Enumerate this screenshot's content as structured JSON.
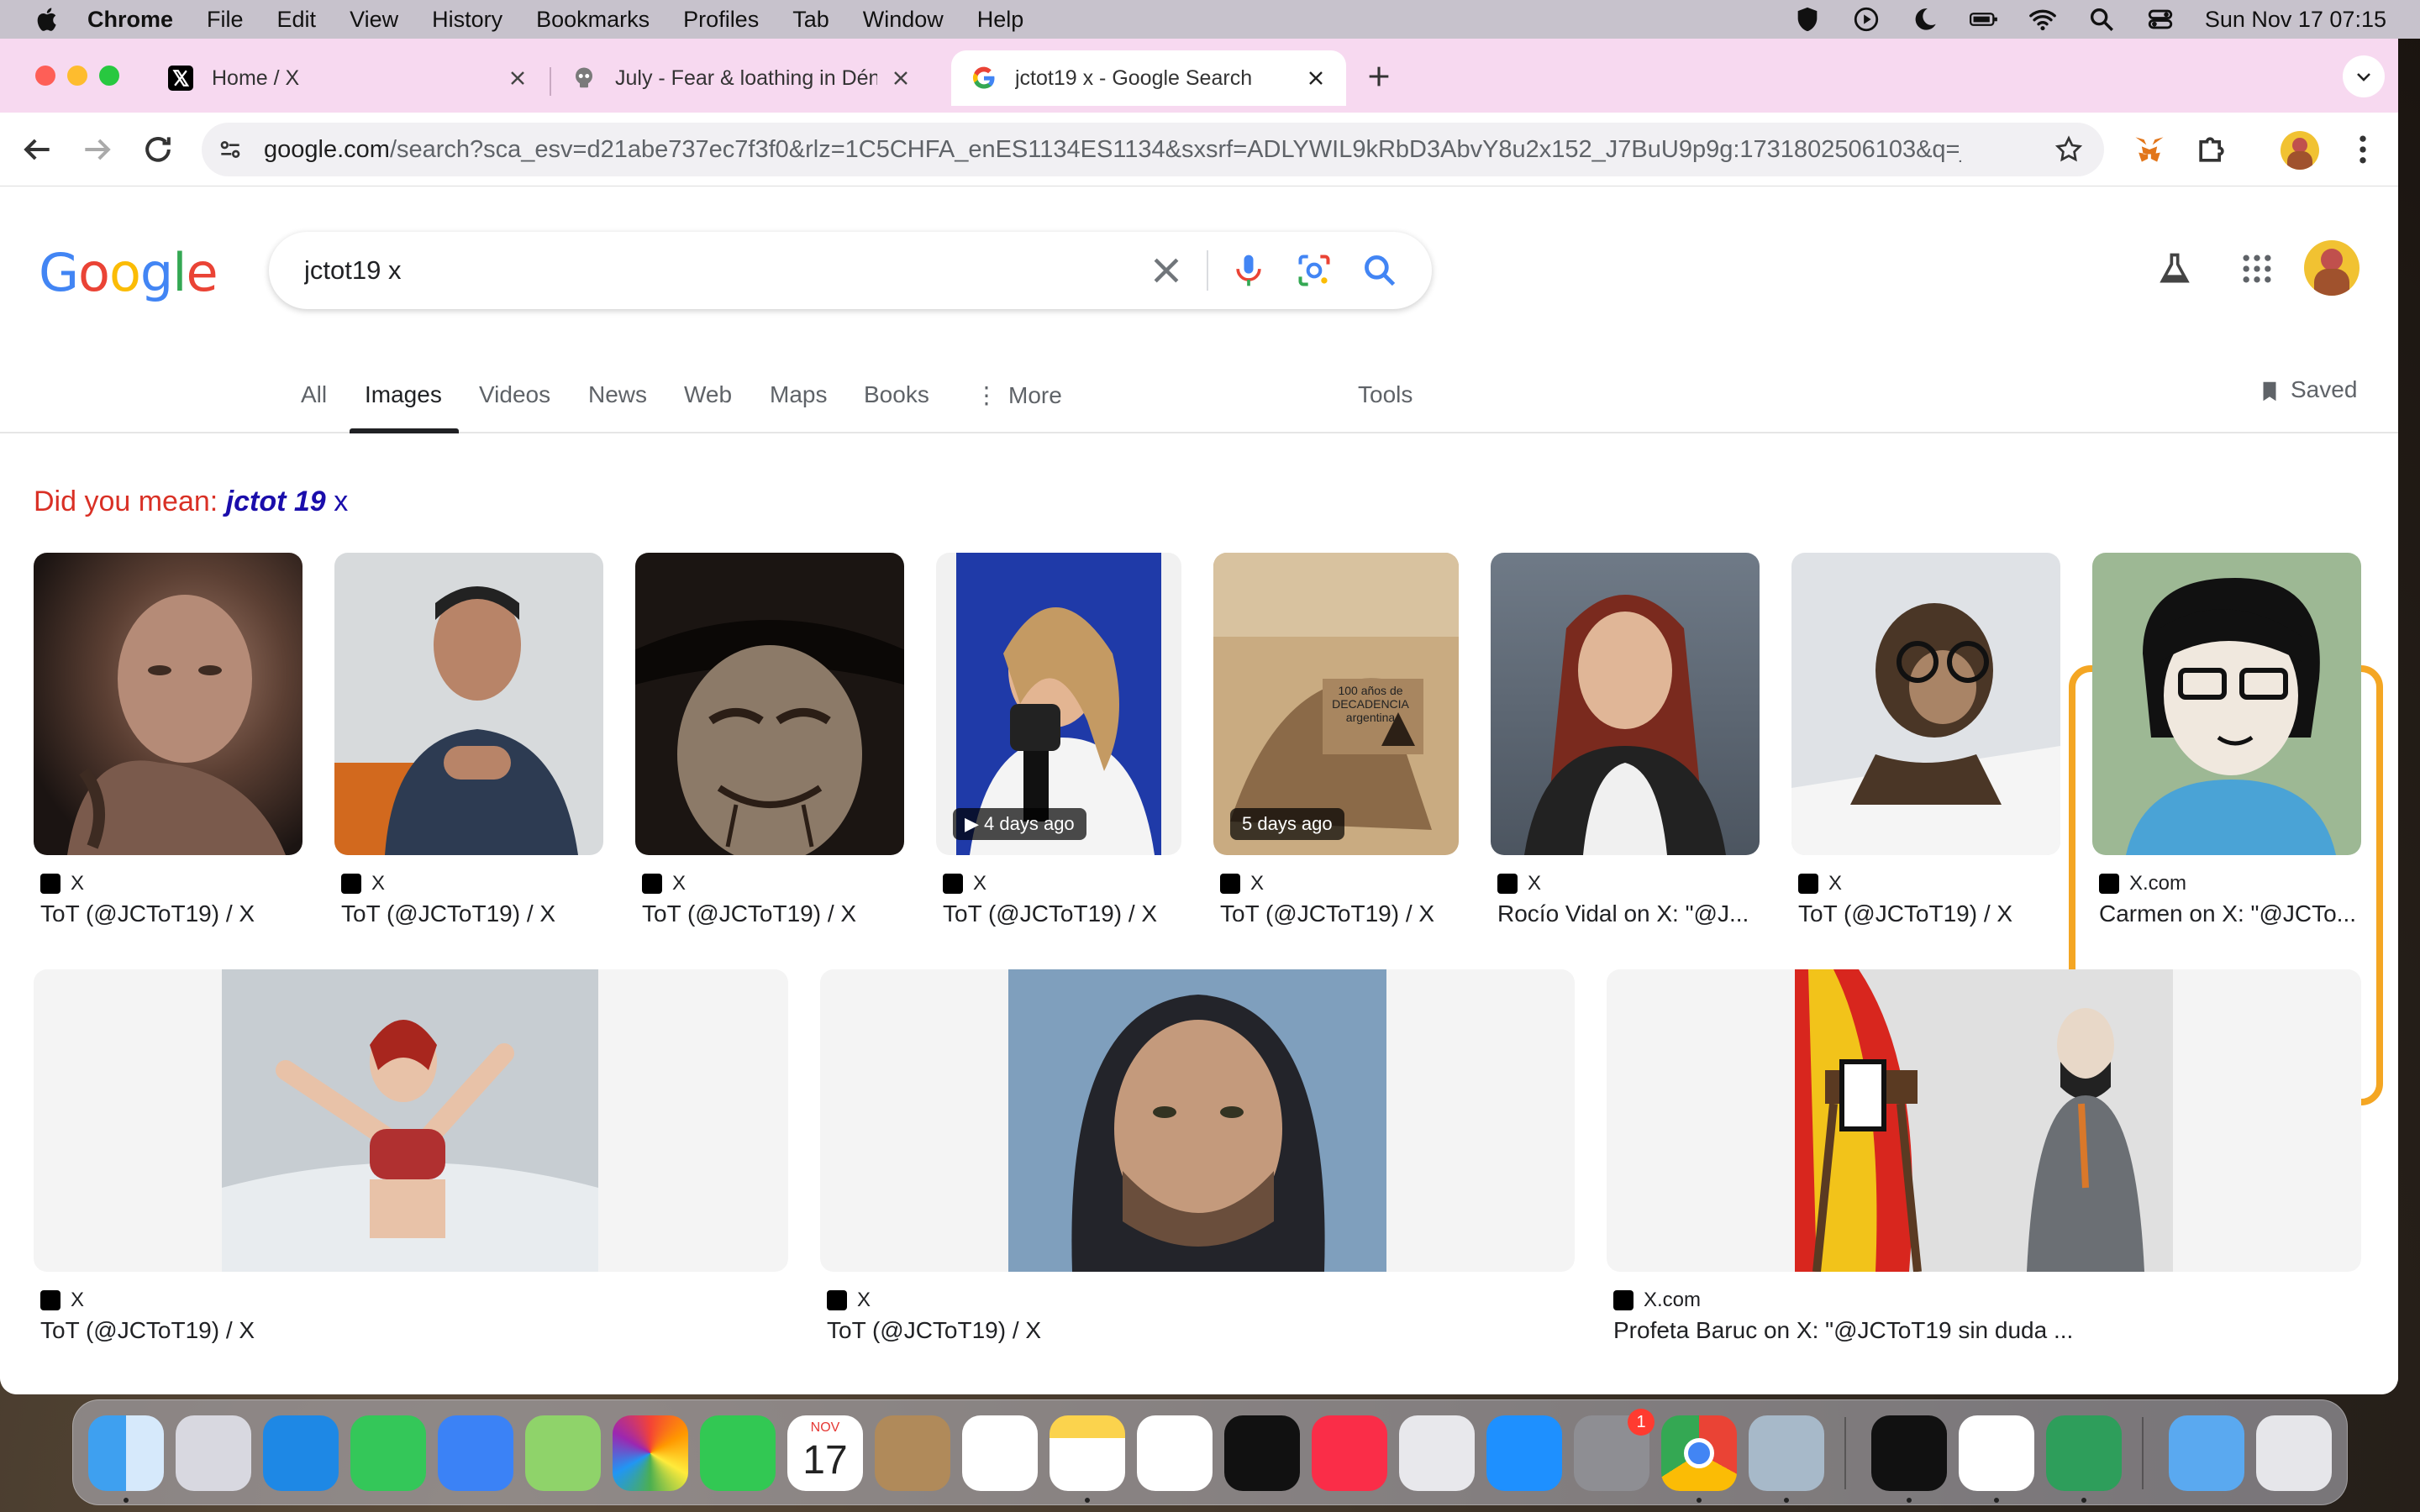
{
  "menubar": {
    "items": [
      "Chrome",
      "File",
      "Edit",
      "View",
      "History",
      "Bookmarks",
      "Profiles",
      "Tab",
      "Window",
      "Help"
    ],
    "clock": "Sun Nov 17  07:15"
  },
  "tabs": [
    {
      "title": "Home / X"
    },
    {
      "title": "July - Fear & loathing in Dénia"
    },
    {
      "title": "jctot19 x - Google Search"
    }
  ],
  "address_bar": {
    "domain": "google.com",
    "path": "/search?sca_esv=d21abe737ec7f3f0&rlz=1C5CHFA_enES1134ES1134&sxsrf=ADLYWIL9kRbD3AbvY8u2x152_J7BuU9p9g:1731802506103&q=jct..."
  },
  "search": {
    "query": "jctot19 x"
  },
  "logo": {
    "letters": [
      "G",
      "o",
      "o",
      "g",
      "l",
      "e"
    ]
  },
  "nav_tabs": [
    "All",
    "Images",
    "Videos",
    "News",
    "Web",
    "Maps",
    "Books",
    "More",
    "Tools"
  ],
  "saved_label": "Saved",
  "did_you_mean": {
    "prefix": "Did you mean:",
    "correction": "jctot 19",
    "rest": "x"
  },
  "results_row1": [
    {
      "source": "X",
      "title": "ToT (@JCToT19) / X"
    },
    {
      "source": "X",
      "title": "ToT (@JCToT19) / X"
    },
    {
      "source": "X",
      "title": "ToT (@JCToT19) / X"
    },
    {
      "source": "X",
      "title": "ToT (@JCToT19) / X",
      "badge": "4 days ago"
    },
    {
      "source": "X",
      "title": "ToT (@JCToT19) / X",
      "badge": "5 days ago"
    },
    {
      "source": "X",
      "title": "Rocío Vidal on X: \"@J..."
    },
    {
      "source": "X",
      "title": "ToT (@JCToT19) / X"
    },
    {
      "source": "X.com",
      "title": "Carmen on X: \"@JCTo..."
    }
  ],
  "results_row2": [
    {
      "source": "X",
      "title": "ToT (@JCToT19) / X"
    },
    {
      "source": "X",
      "title": "ToT (@JCToT19) / X"
    },
    {
      "source": "X.com",
      "title": "Profeta Baruc on X: \"@JCToT19 sin duda ..."
    }
  ],
  "thumb_text": {
    "decadencia": "100 años de DECADENCIA argentina"
  },
  "dock": {
    "calendar_month": "NOV",
    "calendar_day": "17",
    "settings_badge": "1"
  },
  "colors": {
    "accent_highlight": "#f4a623",
    "google_blue": "#4285f4",
    "google_red": "#ea4335",
    "google_yellow": "#fbbc05",
    "google_green": "#34a853"
  }
}
